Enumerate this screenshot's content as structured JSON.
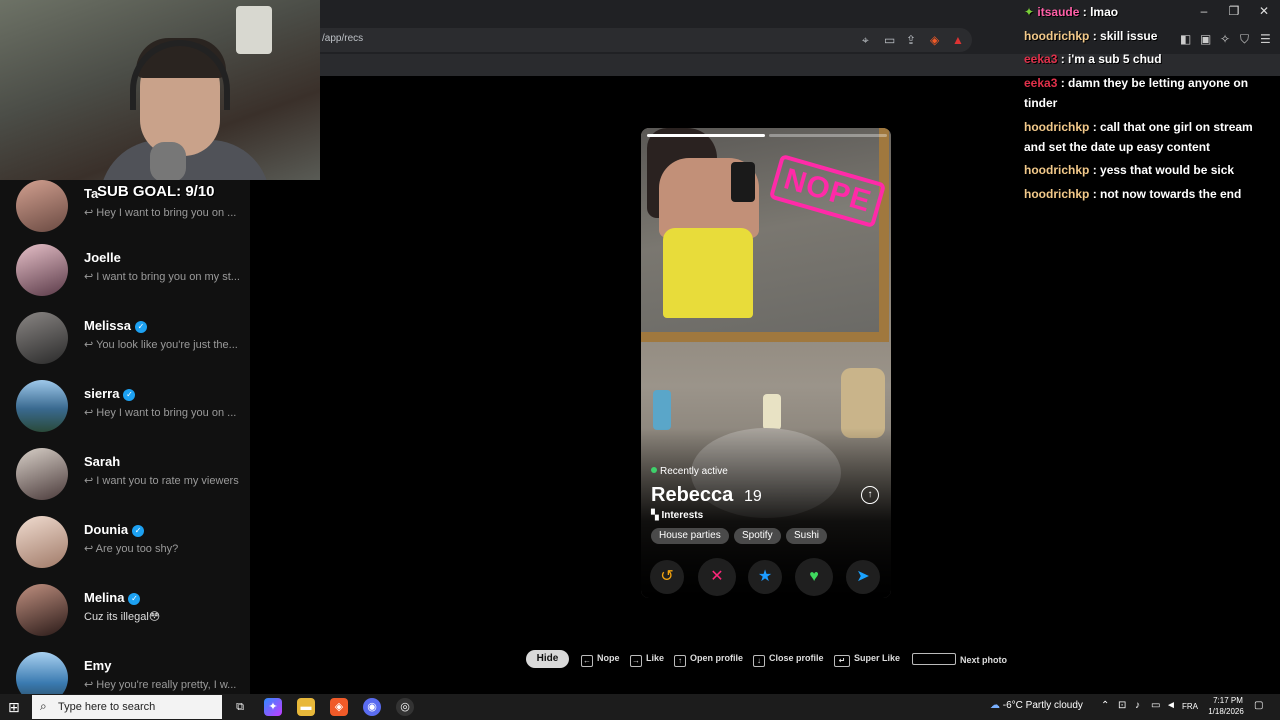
{
  "browser": {
    "url": "/app/recs",
    "window_controls": {
      "minimize": "–",
      "restore": "❐",
      "close": "✕"
    }
  },
  "overlay": {
    "sub_goal": "SUB GOAL: 9/10"
  },
  "sidebar": {
    "items": [
      {
        "name": "Ta",
        "verified": false,
        "preview": "Hey I want to bring you on ...",
        "avatar_color": "#b07a6a"
      },
      {
        "name": "Joelle",
        "verified": false,
        "preview": "I want to bring you on my st...",
        "avatar_color": "#8a6a78"
      },
      {
        "name": "Melissa",
        "verified": true,
        "preview": "You look like you're just the...",
        "avatar_color": "#4a4848"
      },
      {
        "name": "sierra",
        "verified": true,
        "preview": "Hey I want to bring you on ...",
        "avatar_color": "#4a7aa0"
      },
      {
        "name": "Sarah",
        "verified": false,
        "preview": "I want you to rate my viewers",
        "avatar_color": "#6b5a5a"
      },
      {
        "name": "Dounia",
        "verified": true,
        "preview": "Are you too shy?",
        "avatar_color": "#c2a08a"
      },
      {
        "name": "Melina",
        "verified": true,
        "preview": "Cuz its illegal😳",
        "avatar_color": "#5a3a30"
      },
      {
        "name": "Emy",
        "verified": false,
        "preview": "Hey you're really pretty, I w...",
        "avatar_color": "#5a8ab0"
      }
    ]
  },
  "profile": {
    "status": "Recently active",
    "name": "Rebecca",
    "age": "19",
    "interests_label": "Interests",
    "interests": [
      "House parties",
      "Spotify",
      "Sushi"
    ],
    "stamp": "NOPE",
    "info_icon": "↑"
  },
  "actions": {
    "rewind": "↺",
    "nope": "✕",
    "super_like": "★",
    "like": "♥",
    "boost": "➤"
  },
  "colors": {
    "rewind": "#f2a20f",
    "nope": "#fd267a",
    "super_like": "#1c9bff",
    "like": "#3fd95e",
    "boost": "#1aa2ff",
    "stamp": "#ff2aa8"
  },
  "shortcuts": {
    "hide": "Hide",
    "nope": "Nope",
    "like": "Like",
    "open_profile": "Open profile",
    "close_profile": "Close profile",
    "super_like": "Super Like",
    "next_photo": "Next photo"
  },
  "chat": [
    {
      "user": "itsaude",
      "message": ": lmao",
      "color": "#ff5fa8",
      "badge": "✦"
    },
    {
      "user": "hoodrichkp",
      "message": ": skill issue",
      "color": "#f2c98a"
    },
    {
      "user": "eeka3",
      "message": ": i'm a sub 5 chud",
      "color": "#e0304a"
    },
    {
      "user": "eeka3",
      "message": ": damn they be letting anyone on tinder",
      "color": "#e0304a"
    },
    {
      "user": "hoodrichkp",
      "message": ": call that one girl on stream and set the date up easy content",
      "color": "#f2c98a"
    },
    {
      "user": "hoodrichkp",
      "message": ": yess that would be sick",
      "color": "#f2c98a"
    },
    {
      "user": "hoodrichkp",
      "message": ": not now towards the end",
      "color": "#f2c98a"
    }
  ],
  "taskbar": {
    "search_placeholder": "Type here to search",
    "weather": "-6°C  Partly cloudy",
    "language": "FRA",
    "time": "7:17 PM",
    "date": "1/18/2026"
  }
}
